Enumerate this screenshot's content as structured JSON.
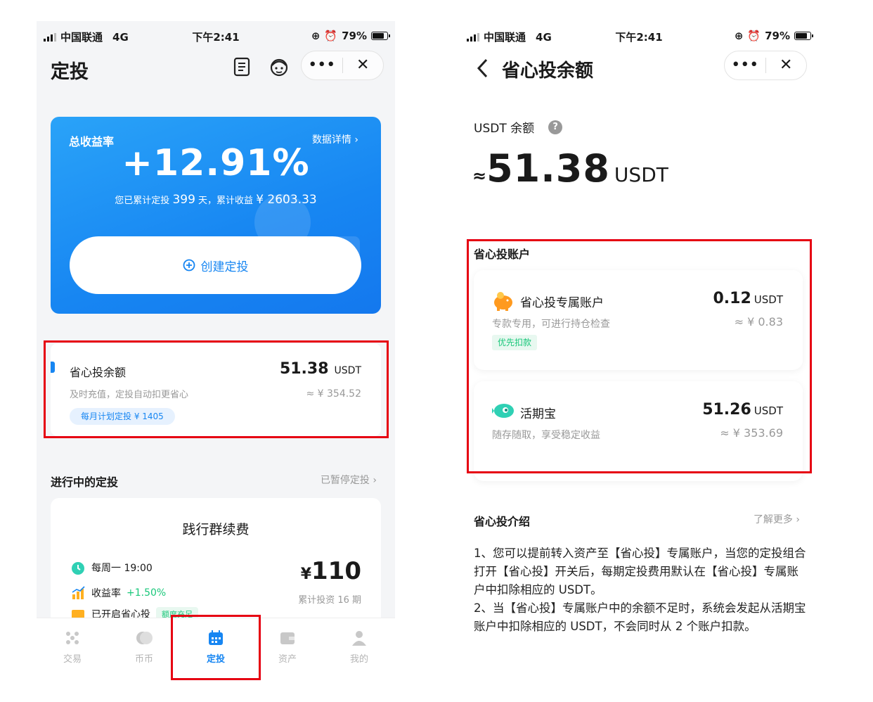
{
  "left": {
    "status": {
      "carrier": "中国联通",
      "network": "4G",
      "time": "下午2:41",
      "battery": "79%"
    },
    "nav": {
      "title": "定投",
      "more": "•••",
      "close": "✕"
    },
    "hero": {
      "label": "总收益率",
      "detail_link": "数据详情",
      "rate": "+12.91%",
      "summary_prefix": "您已累计定投",
      "days": "399",
      "summary_mid": "天，累计收益",
      "earnings": "¥ 2603.33",
      "create_button": "创建定投"
    },
    "balance": {
      "title": "省心投余额",
      "subtitle": "及时充值，定投自动扣更省心",
      "amount": "51.38",
      "unit": "USDT",
      "approx": "≈ ¥ 354.52",
      "tag": "每月计划定投 ¥ 1405"
    },
    "ongoing": {
      "title": "进行中的定投",
      "paused_link": "已暂停定投"
    },
    "plan": {
      "name": "践行群续费",
      "schedule": "每周一 19:00",
      "rate_label": "收益率",
      "rate_value": "+1.50%",
      "saver_label": "已开启省心投",
      "saver_badge": "额度充足",
      "price_symbol": "¥",
      "price": "110",
      "periods": "累计投资 16 期"
    },
    "tabs": [
      {
        "label": "交易"
      },
      {
        "label": "币币"
      },
      {
        "label": "定投"
      },
      {
        "label": "资产"
      },
      {
        "label": "我的"
      }
    ]
  },
  "right": {
    "status": {
      "carrier": "中国联通",
      "network": "4G",
      "time": "下午2:41",
      "battery": "79%"
    },
    "nav": {
      "title": "省心投余额",
      "more": "•••",
      "close": "✕"
    },
    "usdt_label": "USDT 余额",
    "help": "?",
    "balance": {
      "approx_symbol": "≈",
      "value": "51.38",
      "unit": "USDT"
    },
    "accounts_title": "省心投账户",
    "accounts": [
      {
        "name": "省心投专属账户",
        "desc": "专款专用，可进行持仓检查",
        "value": "0.12",
        "unit": "USDT",
        "cny": "≈ ¥ 0.83",
        "tag": "优先扣款"
      },
      {
        "name": "活期宝",
        "desc": "随存随取，享受稳定收益",
        "value": "51.26",
        "unit": "USDT",
        "cny": "≈ ¥ 353.69"
      }
    ],
    "intro": {
      "title": "省心投介绍",
      "more_link": "了解更多",
      "p1": "1、您可以提前转入资产至【省心投】专属账户，当您的定投组合打开【省心投】开关后，每期定投费用默认在【省心投】专属账户中扣除相应的 USDT。",
      "p2": "2、当【省心投】专属账户中的余额不足时，系统会发起从活期宝账户中扣除相应的 USDT，不会同时从 2 个账户扣款。"
    }
  },
  "colors": {
    "primary": "#1786f2",
    "highlight": "#e60012",
    "green": "#19c77a"
  }
}
